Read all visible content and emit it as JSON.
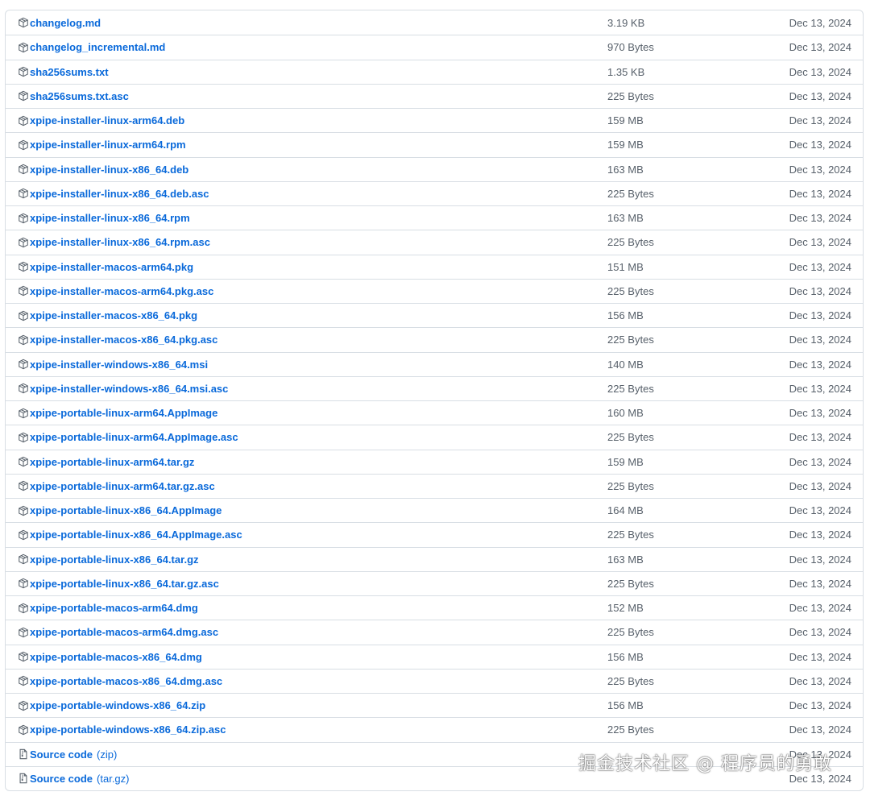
{
  "assets": [
    {
      "name": "changelog.md",
      "size": "3.19 KB",
      "date": "Dec 13, 2024",
      "icon": "package-icon"
    },
    {
      "name": "changelog_incremental.md",
      "size": "970 Bytes",
      "date": "Dec 13, 2024",
      "icon": "package-icon"
    },
    {
      "name": "sha256sums.txt",
      "size": "1.35 KB",
      "date": "Dec 13, 2024",
      "icon": "package-icon"
    },
    {
      "name": "sha256sums.txt.asc",
      "size": "225 Bytes",
      "date": "Dec 13, 2024",
      "icon": "package-icon"
    },
    {
      "name": "xpipe-installer-linux-arm64.deb",
      "size": "159 MB",
      "date": "Dec 13, 2024",
      "icon": "package-icon"
    },
    {
      "name": "xpipe-installer-linux-arm64.rpm",
      "size": "159 MB",
      "date": "Dec 13, 2024",
      "icon": "package-icon"
    },
    {
      "name": "xpipe-installer-linux-x86_64.deb",
      "size": "163 MB",
      "date": "Dec 13, 2024",
      "icon": "package-icon"
    },
    {
      "name": "xpipe-installer-linux-x86_64.deb.asc",
      "size": "225 Bytes",
      "date": "Dec 13, 2024",
      "icon": "package-icon"
    },
    {
      "name": "xpipe-installer-linux-x86_64.rpm",
      "size": "163 MB",
      "date": "Dec 13, 2024",
      "icon": "package-icon"
    },
    {
      "name": "xpipe-installer-linux-x86_64.rpm.asc",
      "size": "225 Bytes",
      "date": "Dec 13, 2024",
      "icon": "package-icon"
    },
    {
      "name": "xpipe-installer-macos-arm64.pkg",
      "size": "151 MB",
      "date": "Dec 13, 2024",
      "icon": "package-icon"
    },
    {
      "name": "xpipe-installer-macos-arm64.pkg.asc",
      "size": "225 Bytes",
      "date": "Dec 13, 2024",
      "icon": "package-icon"
    },
    {
      "name": "xpipe-installer-macos-x86_64.pkg",
      "size": "156 MB",
      "date": "Dec 13, 2024",
      "icon": "package-icon"
    },
    {
      "name": "xpipe-installer-macos-x86_64.pkg.asc",
      "size": "225 Bytes",
      "date": "Dec 13, 2024",
      "icon": "package-icon"
    },
    {
      "name": "xpipe-installer-windows-x86_64.msi",
      "size": "140 MB",
      "date": "Dec 13, 2024",
      "icon": "package-icon"
    },
    {
      "name": "xpipe-installer-windows-x86_64.msi.asc",
      "size": "225 Bytes",
      "date": "Dec 13, 2024",
      "icon": "package-icon"
    },
    {
      "name": "xpipe-portable-linux-arm64.AppImage",
      "size": "160 MB",
      "date": "Dec 13, 2024",
      "icon": "package-icon"
    },
    {
      "name": "xpipe-portable-linux-arm64.AppImage.asc",
      "size": "225 Bytes",
      "date": "Dec 13, 2024",
      "icon": "package-icon"
    },
    {
      "name": "xpipe-portable-linux-arm64.tar.gz",
      "size": "159 MB",
      "date": "Dec 13, 2024",
      "icon": "package-icon"
    },
    {
      "name": "xpipe-portable-linux-arm64.tar.gz.asc",
      "size": "225 Bytes",
      "date": "Dec 13, 2024",
      "icon": "package-icon"
    },
    {
      "name": "xpipe-portable-linux-x86_64.AppImage",
      "size": "164 MB",
      "date": "Dec 13, 2024",
      "icon": "package-icon"
    },
    {
      "name": "xpipe-portable-linux-x86_64.AppImage.asc",
      "size": "225 Bytes",
      "date": "Dec 13, 2024",
      "icon": "package-icon"
    },
    {
      "name": "xpipe-portable-linux-x86_64.tar.gz",
      "size": "163 MB",
      "date": "Dec 13, 2024",
      "icon": "package-icon"
    },
    {
      "name": "xpipe-portable-linux-x86_64.tar.gz.asc",
      "size": "225 Bytes",
      "date": "Dec 13, 2024",
      "icon": "package-icon"
    },
    {
      "name": "xpipe-portable-macos-arm64.dmg",
      "size": "152 MB",
      "date": "Dec 13, 2024",
      "icon": "package-icon"
    },
    {
      "name": "xpipe-portable-macos-arm64.dmg.asc",
      "size": "225 Bytes",
      "date": "Dec 13, 2024",
      "icon": "package-icon"
    },
    {
      "name": "xpipe-portable-macos-x86_64.dmg",
      "size": "156 MB",
      "date": "Dec 13, 2024",
      "icon": "package-icon"
    },
    {
      "name": "xpipe-portable-macos-x86_64.dmg.asc",
      "size": "225 Bytes",
      "date": "Dec 13, 2024",
      "icon": "package-icon"
    },
    {
      "name": "xpipe-portable-windows-x86_64.zip",
      "size": "156 MB",
      "date": "Dec 13, 2024",
      "icon": "package-icon"
    },
    {
      "name": "xpipe-portable-windows-x86_64.zip.asc",
      "size": "225 Bytes",
      "date": "Dec 13, 2024",
      "icon": "package-icon"
    }
  ],
  "source_assets": [
    {
      "name": "Source code",
      "suffix": "(zip)",
      "size": "",
      "date": "Dec 13, 2024",
      "icon": "file-zip-icon"
    },
    {
      "name": "Source code",
      "suffix": "(tar.gz)",
      "size": "",
      "date": "Dec 13, 2024",
      "icon": "file-zip-icon"
    }
  ],
  "watermark": "掘金技术社区 @ 程序员的勇敢",
  "colors": {
    "link": "#0969da",
    "muted": "#57606a",
    "border": "#d8dee4"
  }
}
